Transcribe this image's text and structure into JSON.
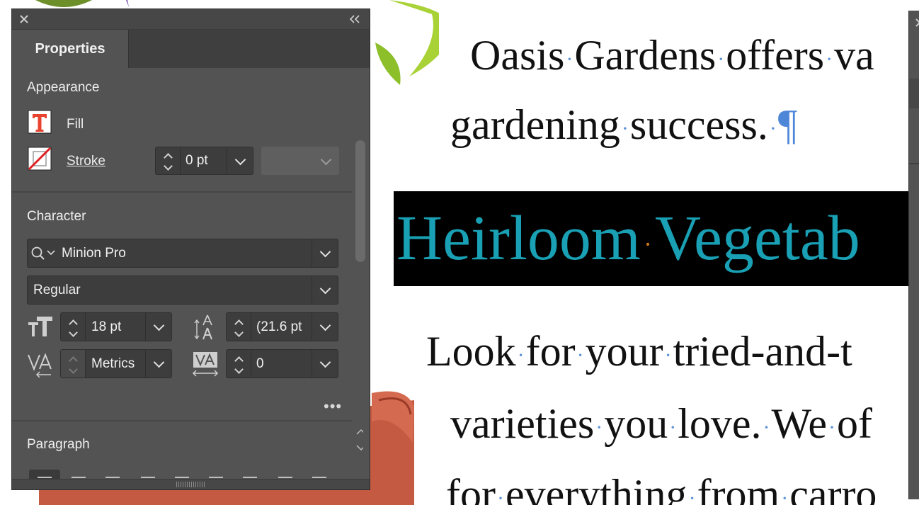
{
  "document": {
    "line_oasis": [
      "Oasis",
      "Gardens",
      "offers",
      "va"
    ],
    "line_garden": [
      "gardening",
      "success."
    ],
    "pilcrow": "¶",
    "heading_words": [
      "Heirloom",
      "Vegetab"
    ],
    "line_look": [
      "Look",
      "for",
      "your",
      "tried-and-t"
    ],
    "line_varieties": [
      "varieties",
      "you",
      "love.",
      "We",
      "of"
    ],
    "line_everything": [
      "for",
      "everything",
      "from",
      "carro"
    ],
    "colors": {
      "heading_text": "#19a0b4",
      "heading_bg": "#000000",
      "hidden_char": "#5a8fd6"
    }
  },
  "panel": {
    "tab": "Properties",
    "appearance": {
      "title": "Appearance",
      "fill_label": "Fill",
      "stroke_label": "Stroke",
      "stroke_weight": "0 pt"
    },
    "character": {
      "title": "Character",
      "font_family": "Minion Pro",
      "font_style": "Regular",
      "font_size": "18 pt",
      "leading": "(21.6 pt",
      "kerning": "Metrics",
      "tracking": "0"
    },
    "more_label": "•••",
    "paragraph": {
      "title": "Paragraph"
    }
  },
  "icons": {
    "close": "close-icon",
    "collapse": "collapse-icon",
    "fill": "fill-text-icon",
    "stroke": "stroke-none-icon",
    "search": "search-icon",
    "font_size": "font-size-icon",
    "leading": "leading-icon",
    "kerning": "kerning-icon",
    "tracking": "tracking-icon"
  }
}
